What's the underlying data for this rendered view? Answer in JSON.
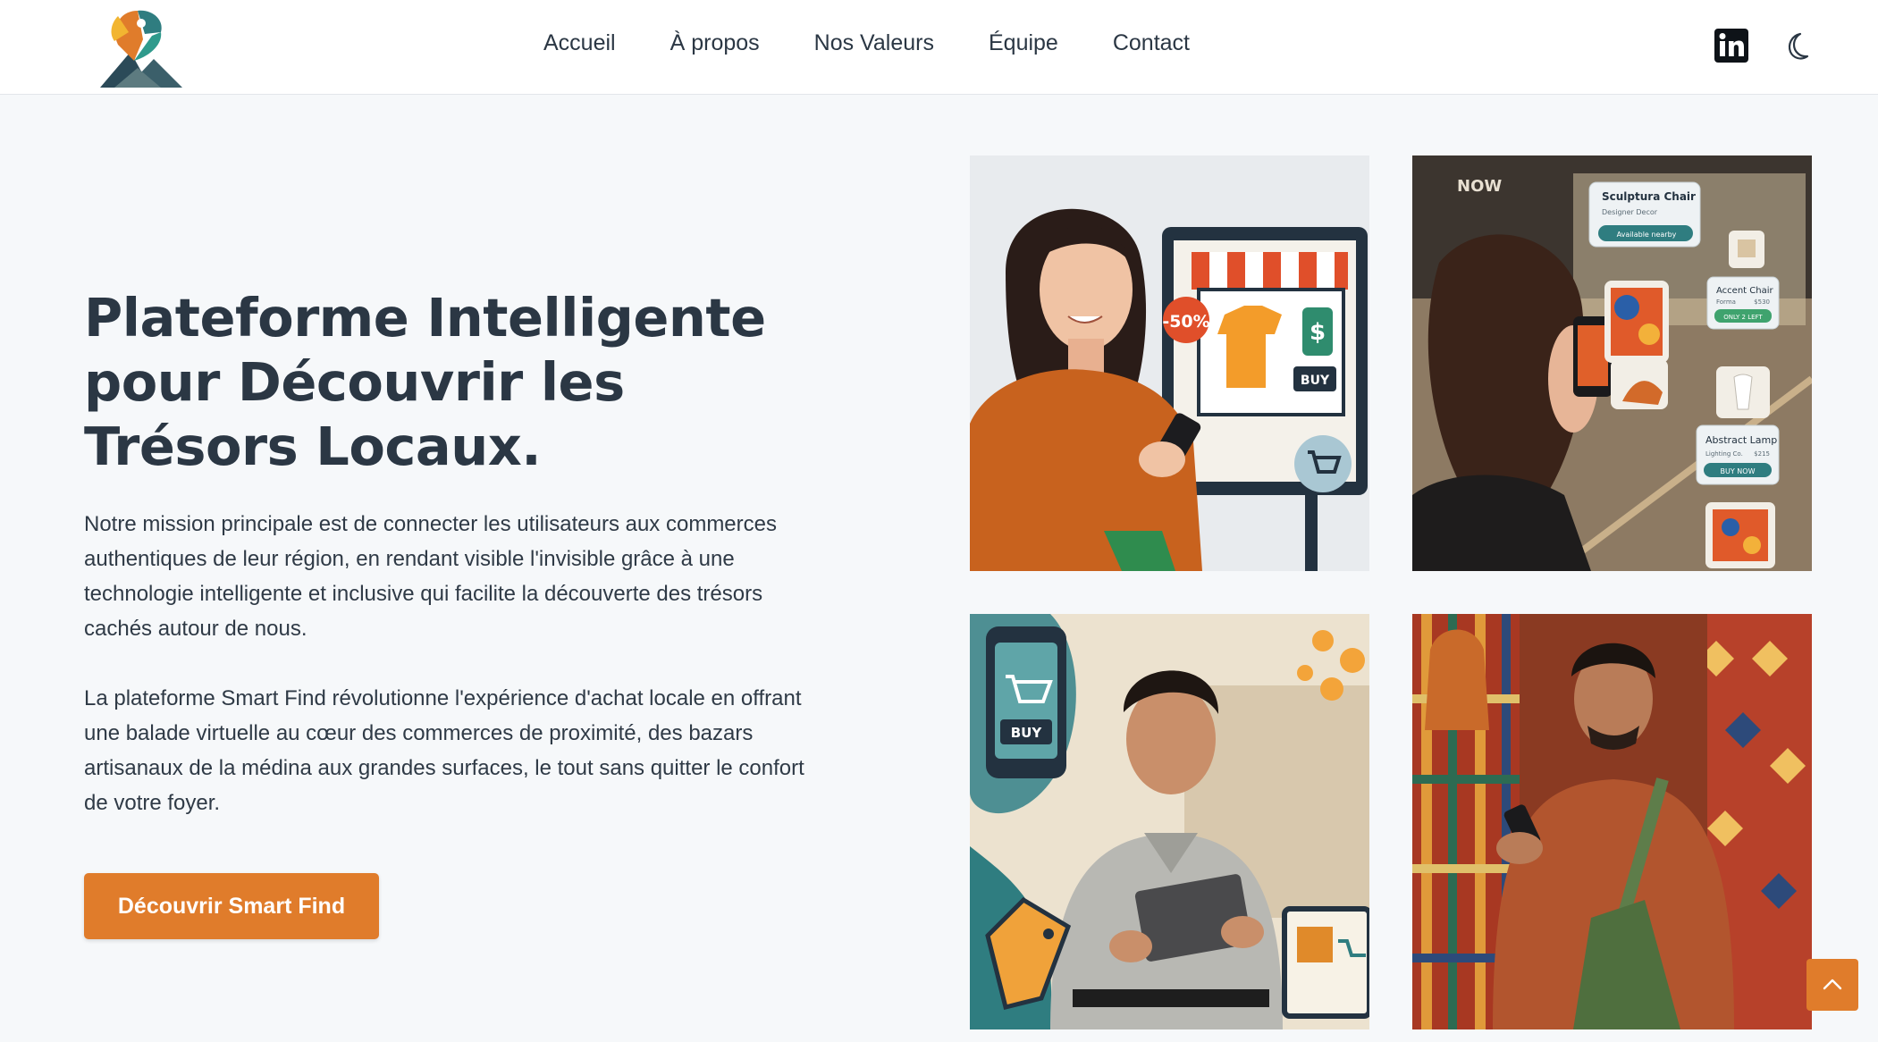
{
  "header": {
    "logo_icon": "smart-find-logo",
    "nav": [
      {
        "label": "Accueil"
      },
      {
        "label": "À propos"
      },
      {
        "label": "Nos Valeurs"
      },
      {
        "label": "Équipe"
      },
      {
        "label": "Contact"
      }
    ],
    "social_icon": "linkedin-icon",
    "theme_icon": "moon-icon"
  },
  "hero": {
    "title": "Plateforme Intelligente pour Découvrir les Trésors Locaux.",
    "paragraph1": "Notre mission principale est de connecter les utilisateurs aux commerces authentiques de leur région, en rendant visible l'invisible grâce à une technologie intelligente et inclusive qui facilite la découverte des trésors cachés autour de nous.",
    "paragraph2": "La plateforme Smart Find révolutionne l'expérience d'achat locale en offrant une balade virtuelle au cœur des commerces de proximité, des bazars artisanaux de la médina aux grandes surfaces, le tout sans quitter le confort de votre foyer.",
    "cta_label": "Découvrir Smart Find"
  },
  "gallery": {
    "tile1": {
      "discount": "-50%",
      "buy": "BUY",
      "price": "$"
    },
    "tile2": {
      "card1_title": "Sculptura Chair",
      "card1_sub": "Designer Decor",
      "card1_badge": "Available nearby",
      "card2_title": "Accent Chair",
      "card2_sub": "Forma",
      "card2_price": "$530",
      "card2_badge": "ONLY 2 LEFT",
      "card3_title": "Abstract Lamp",
      "card3_sub": "Lighting Co.",
      "card3_price": "$215",
      "card3_badge": "BUY NOW",
      "store": "NOW"
    },
    "tile3": {
      "buy": "BUY"
    }
  },
  "colors": {
    "accent": "#e07c2b",
    "text": "#2b3744",
    "background": "#f6f8fa",
    "teal": "#2f7d80"
  },
  "scroll_top_icon": "chevron-up-icon"
}
